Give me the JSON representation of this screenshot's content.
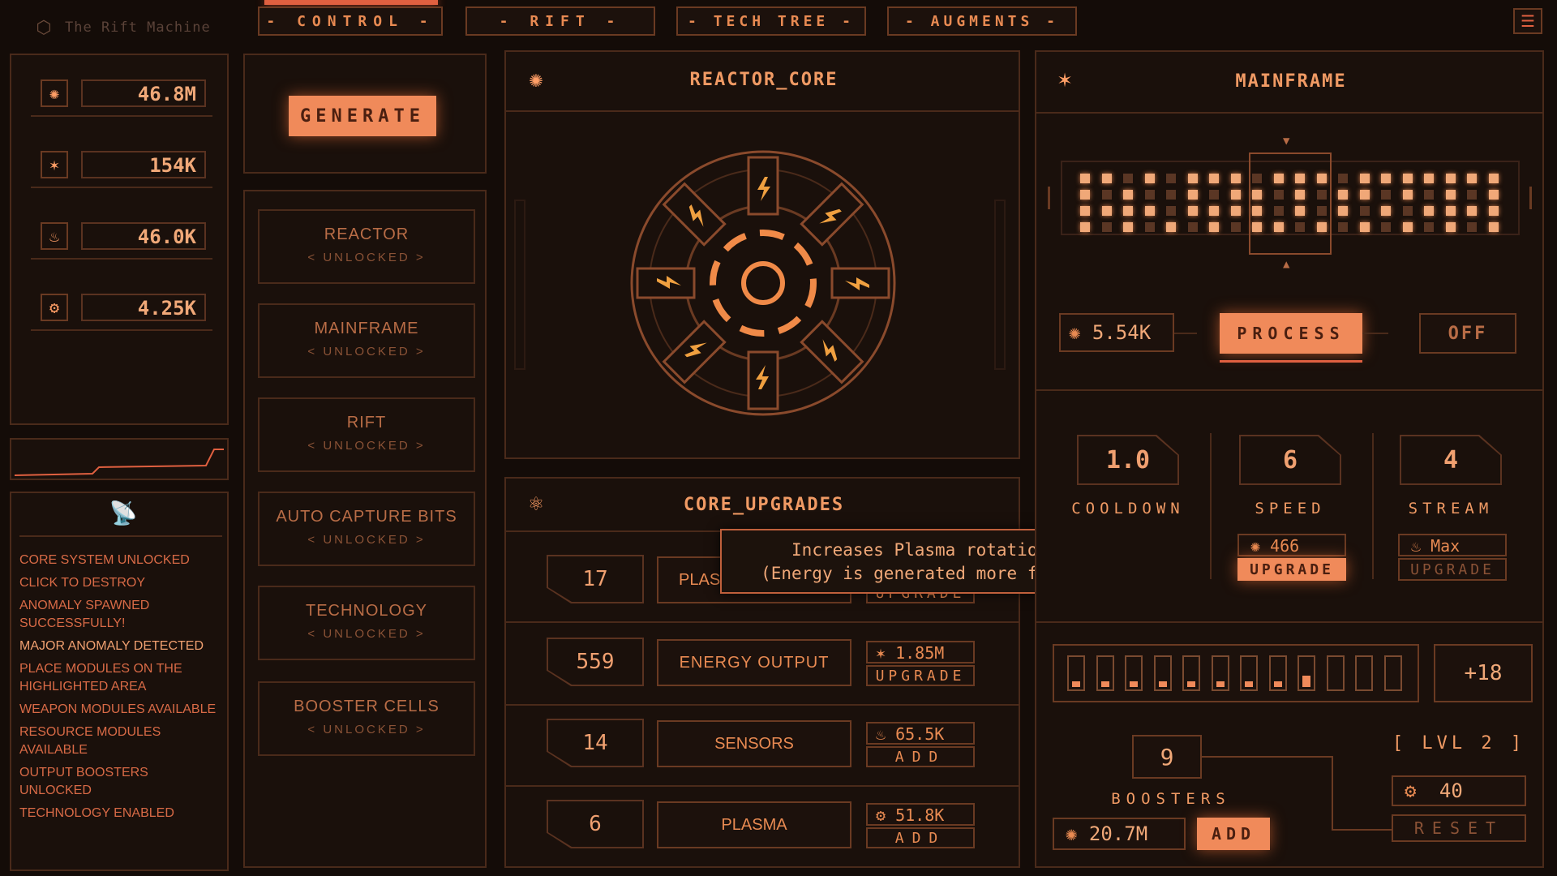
{
  "app": {
    "title": "The Rift Machine"
  },
  "nav": [
    {
      "label": "- CONTROL -"
    },
    {
      "label": "- RIFT -"
    },
    {
      "label": "- TECH TREE -"
    },
    {
      "label": "- AUGMENTS -"
    }
  ],
  "resources": [
    {
      "icon": "fan-icon",
      "value": "46.8M"
    },
    {
      "icon": "star-icon",
      "value": "154K"
    },
    {
      "icon": "flame-icon",
      "value": "46.0K"
    },
    {
      "icon": "gear-icon",
      "value": "4.25K"
    }
  ],
  "log": {
    "icon": "satellite-dish-icon",
    "lines": [
      "CORE SYSTEM UNLOCKED",
      "CLICK TO DESTROY",
      "ANOMALY SPAWNED SUCCESSFULLY!",
      "MAJOR ANOMALY DETECTED",
      "PLACE MODULES ON THE HIGHLIGHTED AREA",
      "WEAPON MODULES AVAILABLE",
      "RESOURCE MODULES AVAILABLE",
      "OUTPUT BOOSTERS UNLOCKED",
      "TECHNOLOGY ENABLED"
    ]
  },
  "generate": {
    "label": "GENERATE"
  },
  "unlocks": [
    {
      "title": "REACTOR",
      "status": "< UNLOCKED >"
    },
    {
      "title": "MAINFRAME",
      "status": "< UNLOCKED >"
    },
    {
      "title": "RIFT",
      "status": "< UNLOCKED >"
    },
    {
      "title": "AUTO CAPTURE BITS",
      "status": "< UNLOCKED >"
    },
    {
      "title": "TECHNOLOGY",
      "status": "< UNLOCKED >"
    },
    {
      "title": "BOOSTER CELLS",
      "status": "< UNLOCKED >"
    }
  ],
  "reactor": {
    "title": "REACTOR_CORE"
  },
  "upgrades": {
    "title": "CORE_UPGRADES",
    "rows": [
      {
        "level": "17",
        "name": "PLASMA ROTATION",
        "cost_icon": "flame-icon",
        "cost": "",
        "action": "UPGRADE"
      },
      {
        "level": "559",
        "name": "ENERGY OUTPUT",
        "cost_icon": "star-icon",
        "cost": "1.85M",
        "action": "UPGRADE"
      },
      {
        "level": "14",
        "name": "SENSORS",
        "cost_icon": "flame-icon",
        "cost": "65.5K",
        "action": "ADD"
      },
      {
        "level": "6",
        "name": "PLASMA",
        "cost_icon": "gear-icon",
        "cost": "51.8K",
        "action": "ADD"
      }
    ],
    "tooltip": {
      "line1": "Increases Plasma rotation speed",
      "line2": "(Energy is generated more frequently)"
    }
  },
  "mainframe": {
    "title": "MAINFRAME",
    "counter_value": "5.54K",
    "process_label": "PROCESS",
    "toggle_label": "OFF",
    "stats": [
      {
        "value": "1.0",
        "label": "COOLDOWN",
        "cost": "",
        "action": ""
      },
      {
        "value": "6",
        "label": "SPEED",
        "cost_icon": "fan-icon",
        "cost": "466",
        "action": "UPGRADE"
      },
      {
        "value": "4",
        "label": "STREAM",
        "cost_icon": "flame-icon",
        "cost": "Max",
        "action": "UPGRADE"
      }
    ],
    "bar_bonus": "+18",
    "bar_fill": [
      0.2,
      0.2,
      0.2,
      0.2,
      0.2,
      0.2,
      0.2,
      0.2,
      0.4,
      0,
      0,
      0
    ],
    "boosters": {
      "count": "9",
      "label": "BOOSTERS",
      "cost_value": "20.7M",
      "add_label": "ADD",
      "level_label": "[ LVL 2 ]",
      "gear_value": "40",
      "reset_label": "RESET"
    }
  },
  "colors": {
    "accent": "#f08a5a",
    "background": "#140c08",
    "panel_border": "#4a2a1a"
  }
}
